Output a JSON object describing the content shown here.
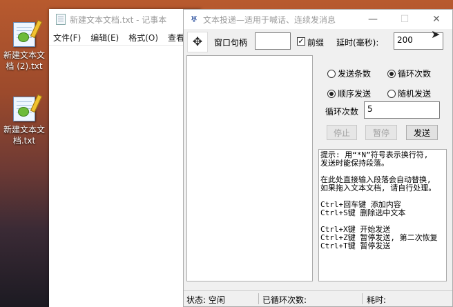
{
  "desktop": {
    "icons": [
      {
        "label_line1": "新建文本文",
        "label_line2": "档 (2).txt"
      },
      {
        "label_line1": "新建文本文",
        "label_line2": "档.txt"
      }
    ]
  },
  "notepad": {
    "title": "新建文本文档.txt - 记事本",
    "menu": [
      "文件(F)",
      "编辑(E)",
      "格式(O)",
      "查看("
    ]
  },
  "app": {
    "title": "文本投递—适用于喊话、连续发消息",
    "window_handle_label": "窗口句柄",
    "window_handle_value": "",
    "prefix_label": "前缀",
    "prefix_checked": true,
    "delay_label": "延时(毫秒):",
    "delay_value": "200",
    "radio_send_count": "发送条数",
    "radio_loop_count": "循环次数",
    "radio_sequential": "顺序发送",
    "radio_random": "随机发送",
    "loop_count_label": "循环次数",
    "loop_count_value": "5",
    "stop_button": "停止",
    "pause_button": "暂停",
    "send_button": "发送",
    "hint_text": "提示: 用“*N”符号表示换行符,\n发送时能保持段落。\n\n在此处直接输入段落会自动替换,\n如果拖入文本文档, 请自行处理。\n\nCtrl+回车键 添加内容\nCtrl+S键 删除选中文本\n\nCtrl+X键 开始发送\nCtrl+Z键 暂停发送, 第二次恢复\nCtrl+T键 暂停发送",
    "status_label": "状态: 空闲",
    "looped_label": "已循环次数:",
    "elapsed_label": "耗时:"
  }
}
